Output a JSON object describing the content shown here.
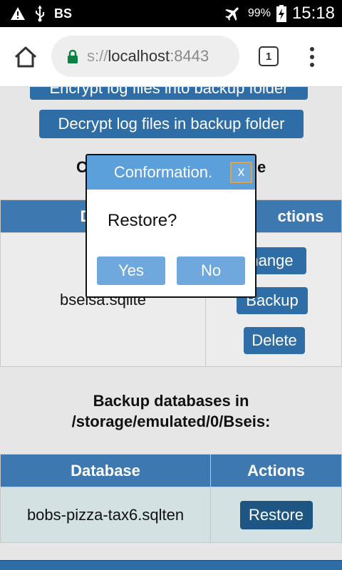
{
  "status_bar": {
    "carrier": "BS",
    "battery": "99%",
    "time": "15:18",
    "icons": [
      "warning-icon",
      "usb-icon",
      "airplane-icon",
      "battery-charging-icon"
    ]
  },
  "browser": {
    "url_prefix": "s://",
    "url_host": "localhost",
    "url_port": ":8443",
    "tab_count": "1",
    "icons": [
      "home-icon",
      "lock-icon",
      "tabs-icon",
      "more-menu-icon"
    ]
  },
  "page": {
    "encrypt_button": "Encrypt log files into backup folder",
    "decrypt_button": "Decrypt log files in backup folder",
    "heading1_left": "C",
    "heading1_right": "e",
    "table1": {
      "headers": [
        "Da",
        "ctions"
      ],
      "row": {
        "database": "bseisa.sqlite",
        "change": "hange",
        "backup": "Backup",
        "delete": "Delete"
      }
    },
    "heading2_line1": "Backup databases in",
    "heading2_line2": "/storage/emulated/0/Bseis:",
    "table2": {
      "headers": [
        "Database",
        "Actions"
      ],
      "row": {
        "database": "bobs-pizza-tax6.sqlten",
        "restore": "Restore"
      }
    }
  },
  "dialog": {
    "title": "Conformation.",
    "close": "x",
    "message": "Restore?",
    "yes": "Yes",
    "no": "No"
  },
  "colors": {
    "primary": "#2f6da6",
    "header": "#3d79b0",
    "dialog_header": "#5b9fdb",
    "dialog_button": "#6ea8dc",
    "restore_button": "#1f5583"
  }
}
